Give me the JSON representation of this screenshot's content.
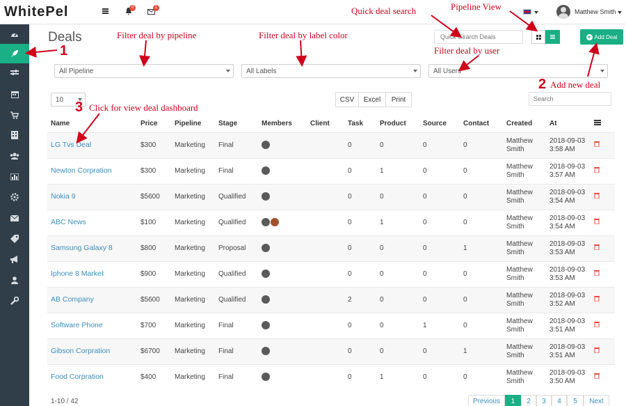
{
  "app": {
    "logo": "WhitePel"
  },
  "topbar": {
    "notify_count": "0",
    "mail_count": "1",
    "user_name": "Matthew Smith"
  },
  "page": {
    "title": "Deals"
  },
  "search": {
    "quick_placeholder": "Quick Search Deals",
    "table_placeholder": "Search"
  },
  "buttons": {
    "add_deal": "Add Deal",
    "csv": "CSV",
    "excel": "Excel",
    "print": "Print"
  },
  "filters": {
    "pipeline": "All Pipeline",
    "labels": "All Labels",
    "users": "All Users",
    "page_size": "10"
  },
  "annotations": {
    "pipeline": "Filter deal by pipeline",
    "label": "Filter deal by label color",
    "quick_search": "Quick deal search",
    "pipeline_view": "Pipeline View",
    "user": "Filter deal by user",
    "add_new": "Add new deal",
    "dashboard": "Click for view deal dashboard",
    "n1": "1",
    "n2": "2",
    "n3": "3"
  },
  "table": {
    "columns": [
      "Name",
      "Price",
      "Pipeline",
      "Stage",
      "Members",
      "Client",
      "Task",
      "Product",
      "Source",
      "Contact",
      "Created",
      "At"
    ],
    "rows": [
      {
        "name": "LG Tvs Deal",
        "price": "$300",
        "pipeline": "Marketing",
        "stage": "Final",
        "task": "0",
        "product": "0",
        "source": "0",
        "contact": "0",
        "created": "Matthew Smith",
        "at": "2018-09-03 3:58 AM"
      },
      {
        "name": "Newton Corpration",
        "price": "$300",
        "pipeline": "Marketing",
        "stage": "Final",
        "task": "0",
        "product": "1",
        "source": "0",
        "contact": "0",
        "created": "Matthew Smith",
        "at": "2018-09-03 3:57 AM"
      },
      {
        "name": "Nokia 9",
        "price": "$5600",
        "pipeline": "Marketing",
        "stage": "Qualified",
        "task": "0",
        "product": "0",
        "source": "0",
        "contact": "0",
        "created": "Matthew Smith",
        "at": "2018-09-03 3:54 AM"
      },
      {
        "name": "ABC News",
        "price": "$100",
        "pipeline": "Marketing",
        "stage": "Qualified",
        "task": "0",
        "product": "1",
        "source": "0",
        "contact": "0",
        "created": "Matthew Smith",
        "at": "2018-09-03 3:54 AM"
      },
      {
        "name": "Samsung Galaxy 8",
        "price": "$800",
        "pipeline": "Marketing",
        "stage": "Proposal",
        "task": "0",
        "product": "0",
        "source": "0",
        "contact": "1",
        "created": "Matthew Smith",
        "at": "2018-09-03 3:53 AM"
      },
      {
        "name": "Iphone 8 Market",
        "price": "$900",
        "pipeline": "Marketing",
        "stage": "Qualified",
        "task": "0",
        "product": "0",
        "source": "0",
        "contact": "0",
        "created": "Matthew Smith",
        "at": "2018-09-03 3:53 AM"
      },
      {
        "name": "AB Company",
        "price": "$5600",
        "pipeline": "Marketing",
        "stage": "Qualified",
        "task": "2",
        "product": "0",
        "source": "0",
        "contact": "0",
        "created": "Matthew Smith",
        "at": "2018-09-03 3:52 AM"
      },
      {
        "name": "Software Phone",
        "price": "$700",
        "pipeline": "Marketing",
        "stage": "Final",
        "task": "0",
        "product": "0",
        "source": "1",
        "contact": "0",
        "created": "Matthew Smith",
        "at": "2018-09-03 3:51 AM"
      },
      {
        "name": "Gibson Corpration",
        "price": "$6700",
        "pipeline": "Marketing",
        "stage": "Final",
        "task": "0",
        "product": "0",
        "source": "0",
        "contact": "1",
        "created": "Matthew Smith",
        "at": "2018-09-03 3:51 AM"
      },
      {
        "name": "Food Corpration",
        "price": "$400",
        "pipeline": "Marketing",
        "stage": "Final",
        "task": "0",
        "product": "1",
        "source": "0",
        "contact": "0",
        "created": "Matthew Smith",
        "at": "2018-09-03 3:50 AM"
      }
    ]
  },
  "footer": {
    "range": "1-10 / 42"
  },
  "pagination": {
    "previous": "Previous",
    "p1": "1",
    "p2": "2",
    "p3": "3",
    "p4": "4",
    "p5": "5",
    "next": "Next"
  },
  "colors": {
    "accent": "#1aaf84",
    "sidebar": "#2f3e49",
    "annotation": "#d0021b",
    "link": "#3c8dbc"
  }
}
